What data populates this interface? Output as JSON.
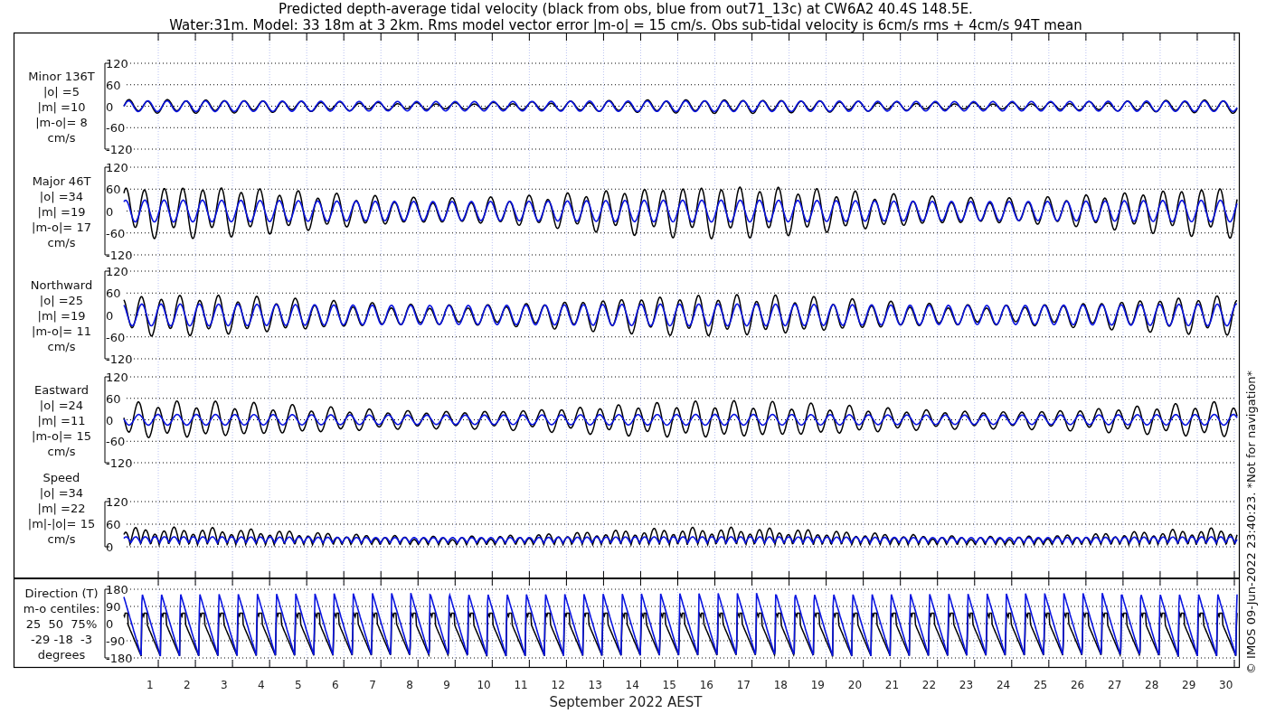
{
  "title_lines": [
    "Predicted depth-average tidal velocity (black from obs, blue from out71_13c) at CW6A2 40.4S 148.5E.",
    "Water:31m. Model: 33 18m at 3 2km. Rms model vector error |m-o| = 15 cm/s. Obs sub-tidal velocity is 6cm/s rms + 4cm/s 94T mean"
  ],
  "panels": [
    {
      "kind": "velocity",
      "label_lines": [
        "Minor 136T",
        "|o| =5",
        "|m| =10",
        "|m-o|= 8",
        "cm/s"
      ],
      "yticks": [
        "120",
        "60",
        "0",
        "-60",
        "-120"
      ]
    },
    {
      "kind": "velocity",
      "label_lines": [
        "Major 46T",
        "|o| =34",
        "|m| =19",
        "|m-o|= 17",
        "cm/s"
      ],
      "yticks": [
        "120",
        "60",
        "0",
        "-60",
        "-120"
      ]
    },
    {
      "kind": "velocity",
      "label_lines": [
        "Northward",
        "|o| =25",
        "|m| =19",
        "|m-o|= 11",
        "cm/s"
      ],
      "yticks": [
        "120",
        "60",
        "0",
        "-60",
        "-120"
      ]
    },
    {
      "kind": "velocity",
      "label_lines": [
        "Eastward",
        "|o| =24",
        "|m| =11",
        "|m-o|= 15",
        "cm/s"
      ],
      "yticks": [
        "120",
        "60",
        "0",
        "-60",
        "-120"
      ]
    },
    {
      "kind": "speed",
      "label_lines": [
        "Speed",
        "|o| =34",
        "|m| =22",
        "|m|-|o|= 15",
        "cm/s"
      ],
      "yticks": [
        "120",
        "60",
        "0"
      ]
    },
    {
      "kind": "direction",
      "label_lines": [
        "Direction (T)",
        "m-o centiles:",
        "25  50  75%",
        "-29 -18  -3",
        "degrees"
      ],
      "yticks": [
        "180",
        "90",
        "0",
        "-90",
        "-180"
      ]
    }
  ],
  "x_axis": {
    "ticks": [
      "1",
      "2",
      "3",
      "4",
      "5",
      "6",
      "7",
      "8",
      "9",
      "10",
      "11",
      "12",
      "13",
      "14",
      "15",
      "16",
      "17",
      "18",
      "19",
      "20",
      "21",
      "22",
      "23",
      "24",
      "25",
      "26",
      "27",
      "28",
      "29",
      "30"
    ],
    "label": "September 2022 AEST"
  },
  "credit": "© IMOS 09-Jun-2022 23:40:23. *Not for navigation*"
}
